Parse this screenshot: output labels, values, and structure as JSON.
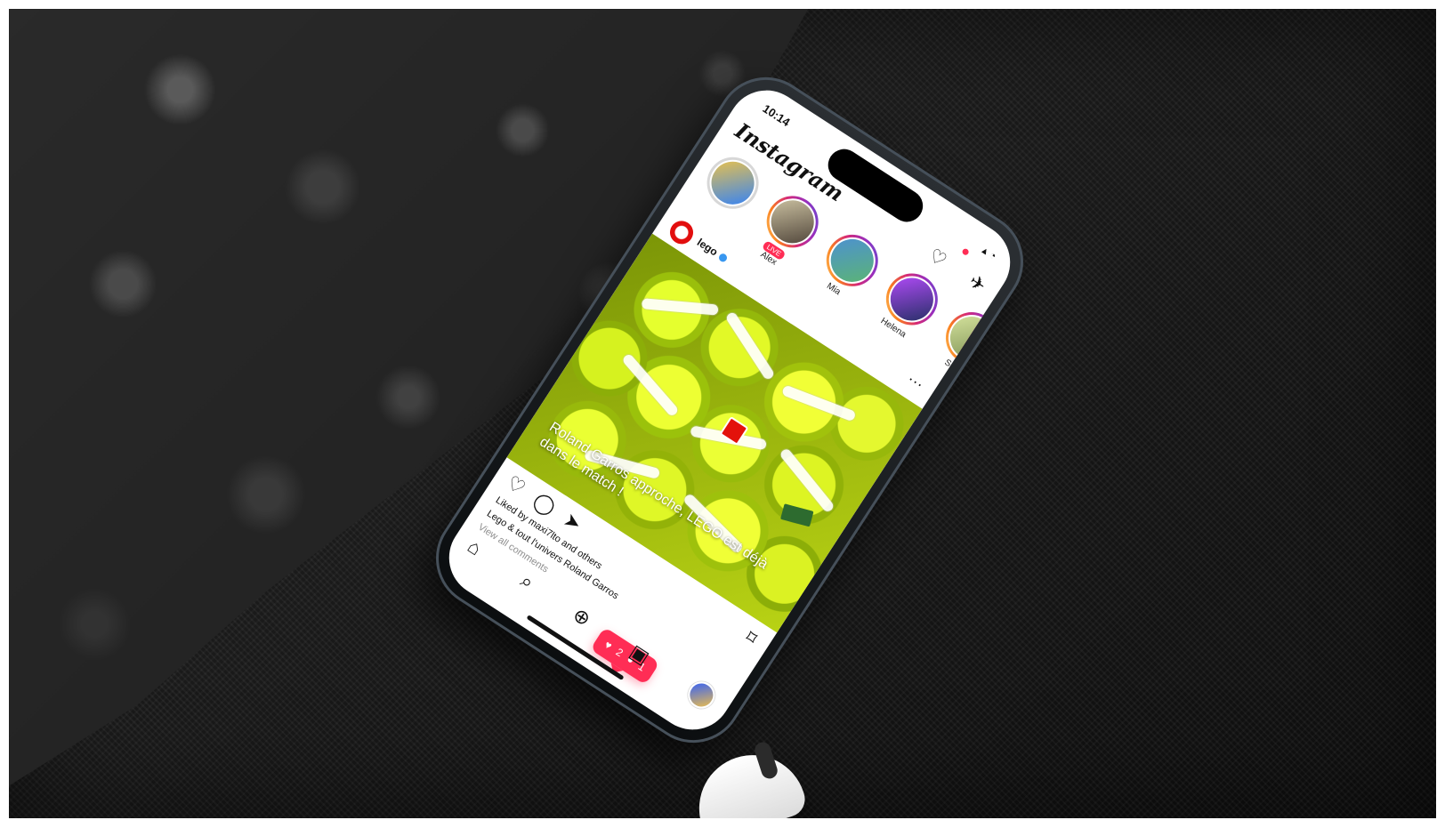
{
  "phone": {
    "status": {
      "time": "10:14",
      "icons": "▴ ◔"
    },
    "app": {
      "logo": "Instagram",
      "top_icons": [
        "heart-icon",
        "direct-message-icon"
      ]
    },
    "stories": [
      {
        "label": "",
        "ring": "plain",
        "badge": "",
        "color_a": "#f4c542",
        "color_b": "#2a7fff"
      },
      {
        "label": "Alex",
        "ring": "gradient",
        "badge": "LIVE",
        "color_a": "#d1c7a6",
        "color_b": "#4a3f35"
      },
      {
        "label": "Mia",
        "ring": "gradient",
        "badge": "",
        "color_a": "#4c8fd6",
        "color_b": "#5cb66f"
      },
      {
        "label": "Helena",
        "ring": "gradient",
        "badge": "",
        "color_a": "#b84cff",
        "color_b": "#1e2e5e"
      },
      {
        "label": "Sam",
        "ring": "gradient",
        "badge": "",
        "color_a": "#d9e6a0",
        "color_b": "#7a8e52"
      }
    ],
    "post": {
      "username": "lego",
      "more": "···",
      "overlay_caption": "Roland Garros approche, LEGO est déjà dans le match !",
      "likes": "Liked by maxi7lto and others",
      "caption": "Lego & tout l'univers Roland Garros",
      "comments": "View all comments",
      "notification_counts": {
        "likes": "2",
        "comments": "1"
      }
    },
    "nav": {
      "items": [
        "home-icon",
        "search-icon",
        "create-icon",
        "reels-icon",
        "profile-avatar"
      ]
    }
  }
}
